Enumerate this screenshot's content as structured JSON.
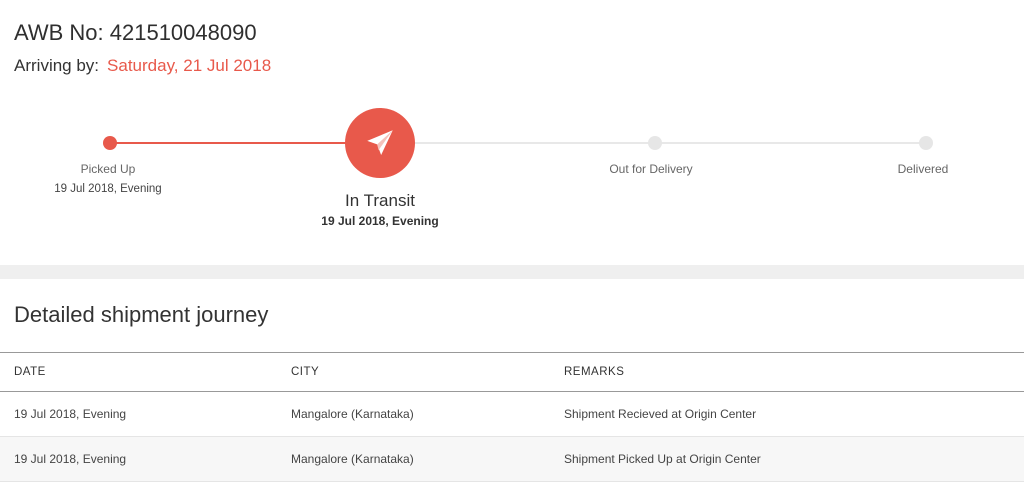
{
  "header": {
    "awb_label": "AWB No: 421510048090",
    "arriving_label": "Arriving by:",
    "arriving_date": "Saturday, 21 Jul 2018"
  },
  "tracker": {
    "stages": [
      {
        "label": "Picked Up",
        "sub": "19 Jul 2018, Evening",
        "status": "done"
      },
      {
        "label": "In Transit",
        "sub": "19 Jul 2018, Evening",
        "status": "current"
      },
      {
        "label": "Out for Delivery",
        "sub": "",
        "status": "pending"
      },
      {
        "label": "Delivered",
        "sub": "",
        "status": "pending"
      }
    ],
    "accent_color": "#e8594b",
    "current_icon": "paper-plane-icon"
  },
  "journey": {
    "title": "Detailed shipment journey",
    "columns": [
      "DATE",
      "CITY",
      "REMARKS"
    ],
    "rows": [
      {
        "date": "19 Jul 2018, Evening",
        "city": "Mangalore (Karnataka)",
        "remarks": "Shipment Recieved at Origin Center"
      },
      {
        "date": "19 Jul 2018, Evening",
        "city": "Mangalore (Karnataka)",
        "remarks": "Shipment Picked Up at Origin Center"
      }
    ]
  }
}
